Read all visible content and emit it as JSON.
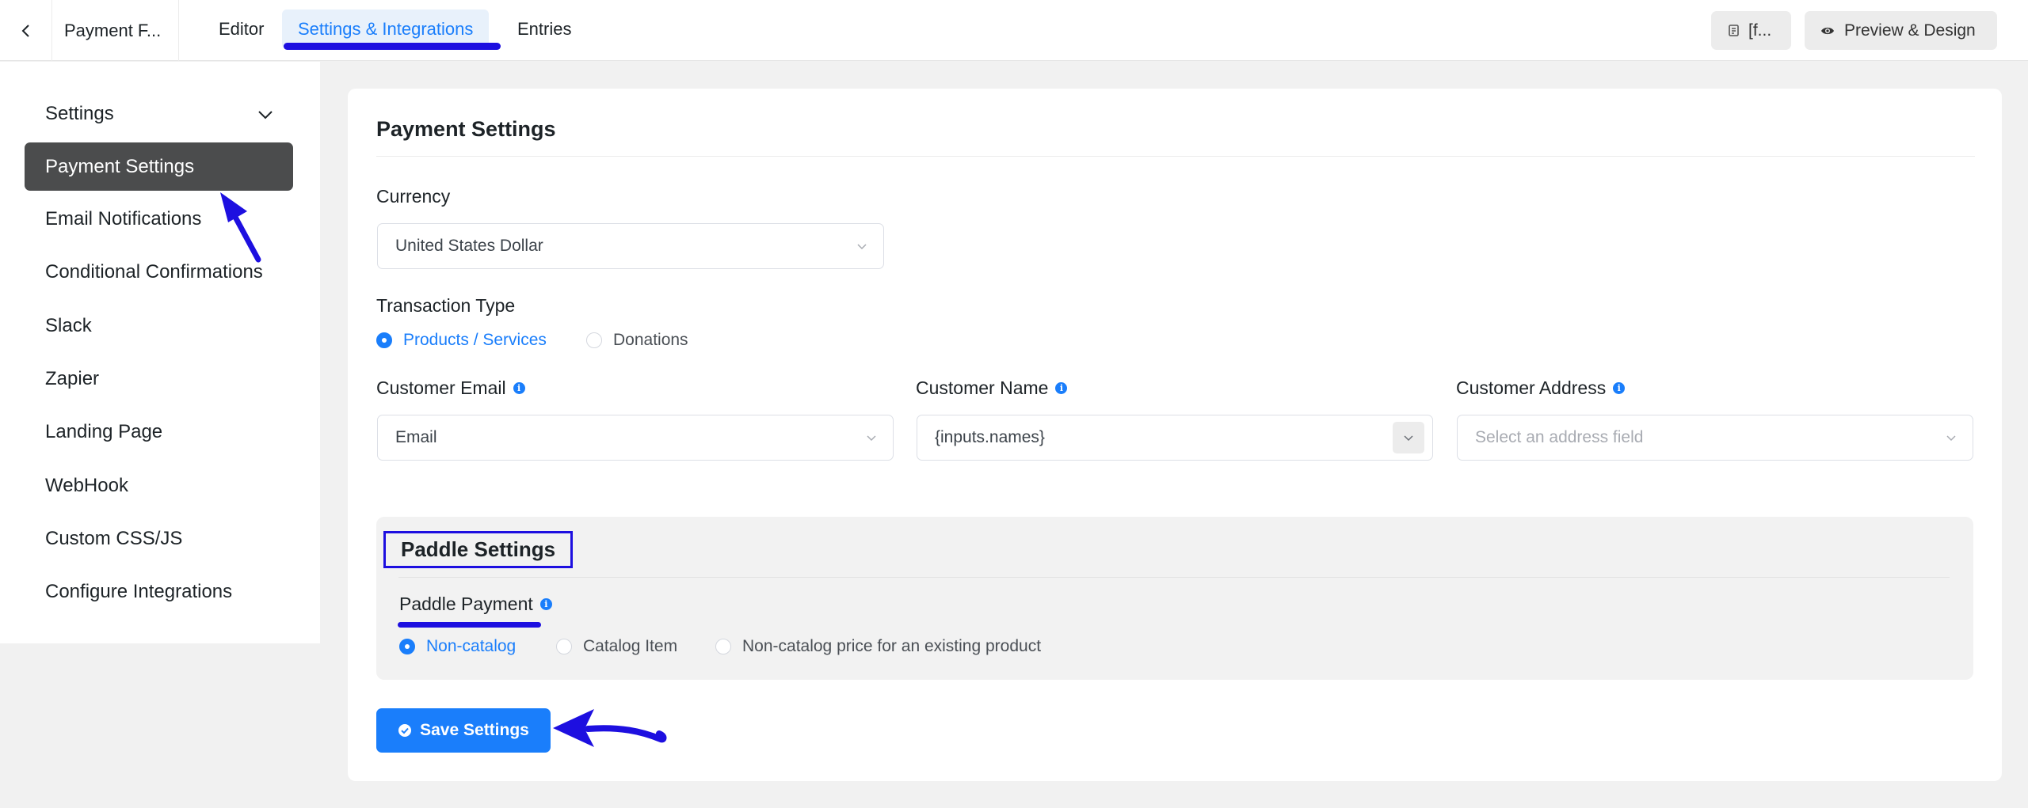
{
  "header": {
    "form_title": "Payment F...",
    "tabs": [
      {
        "label": "Editor"
      },
      {
        "label": "Settings & Integrations"
      },
      {
        "label": "Entries"
      }
    ],
    "shortcode_label": "[f...",
    "preview_label": "Preview & Design"
  },
  "sidebar": {
    "items": [
      {
        "label": "Settings"
      },
      {
        "label": "Payment Settings"
      },
      {
        "label": "Email Notifications"
      },
      {
        "label": "Conditional Confirmations"
      },
      {
        "label": "Slack"
      },
      {
        "label": "Zapier"
      },
      {
        "label": "Landing Page"
      },
      {
        "label": "WebHook"
      },
      {
        "label": "Custom CSS/JS"
      },
      {
        "label": "Configure Integrations"
      }
    ]
  },
  "main": {
    "title": "Payment Settings",
    "currency": {
      "label": "Currency",
      "value": "United States Dollar"
    },
    "transaction_type": {
      "label": "Transaction Type",
      "options": [
        {
          "label": "Products / Services",
          "selected": true
        },
        {
          "label": "Donations",
          "selected": false
        }
      ]
    },
    "customer_email": {
      "label": "Customer Email",
      "value": "Email"
    },
    "customer_name": {
      "label": "Customer Name",
      "value": "{inputs.names}"
    },
    "customer_address": {
      "label": "Customer Address",
      "placeholder": "Select an address field"
    },
    "paddle": {
      "title": "Paddle Settings",
      "payment_label": "Paddle Payment",
      "options": [
        {
          "label": "Non-catalog",
          "selected": true
        },
        {
          "label": "Catalog Item",
          "selected": false
        },
        {
          "label": "Non-catalog price for an existing product",
          "selected": false
        }
      ]
    },
    "save_label": "Save Settings"
  },
  "colors": {
    "accent": "#1a7efb",
    "annotation": "#1d0fe0",
    "active_sidebar": "#4b4c4d"
  }
}
